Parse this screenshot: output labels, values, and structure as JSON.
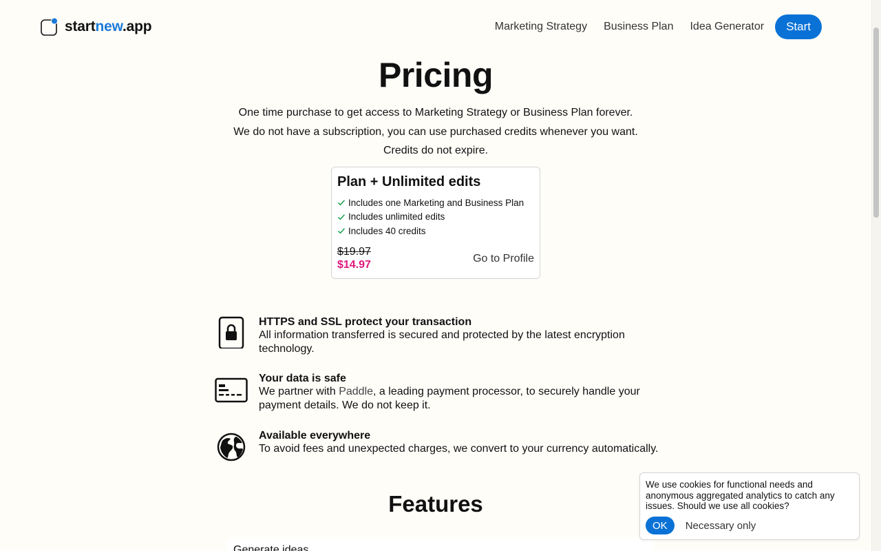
{
  "header": {
    "logo": {
      "part1": "start",
      "part2": "new",
      "part3": ".app"
    },
    "nav": [
      "Marketing Strategy",
      "Business Plan",
      "Idea Generator"
    ],
    "start_label": "Start"
  },
  "hero": {
    "title": "Pricing",
    "subtitle_lines": [
      "One time purchase to get access to Marketing Strategy or Business Plan forever.",
      "We do not have a subscription, you can use purchased credits whenever you want.",
      "Credits do not expire."
    ]
  },
  "card": {
    "title": "Plan + Unlimited edits",
    "features": [
      "Includes one Marketing and Business Plan",
      "Includes unlimited edits",
      "Includes 40 credits"
    ],
    "old_price": "$19.97",
    "new_price": "$14.97",
    "profile_link": "Go to Profile"
  },
  "trust": [
    {
      "icon": "lock-icon",
      "title": "HTTPS and SSL protect your transaction",
      "desc": "All information transferred is secured and protected by the latest encryption technology."
    },
    {
      "icon": "credit-card-icon",
      "title": "Your data is safe",
      "desc_pre": "We partner with ",
      "desc_link": "Paddle",
      "desc_post": ", a leading payment processor, to securely handle your payment details. We do not keep it."
    },
    {
      "icon": "globe-icon",
      "title": "Available everywhere",
      "desc": "To avoid fees and unexpected charges, we convert to your currency automatically."
    }
  ],
  "features": {
    "title": "Features",
    "first_item": "Generate ideas"
  },
  "cookie": {
    "text": "We use cookies for functional needs and anonymous aggregated analytics to catch any issues. Should we use all cookies?",
    "ok_label": "OK",
    "necessary_label": "Necessary only"
  },
  "colors": {
    "accent": "#0a72d6",
    "price": "#e0197d",
    "background": "#fffdf8"
  }
}
